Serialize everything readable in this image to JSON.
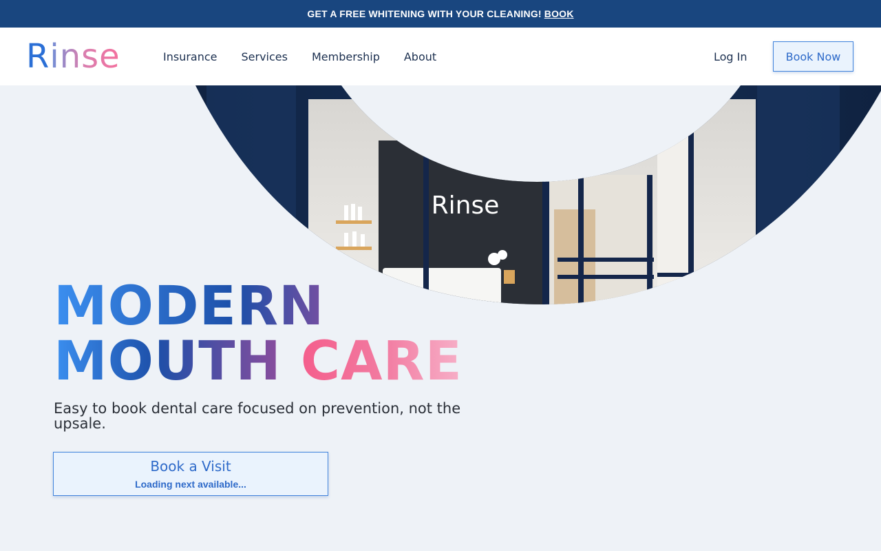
{
  "promo": {
    "text": "GET A FREE WHITENING WITH YOUR CLEANING!",
    "link": "BOOK"
  },
  "brand": {
    "logo_first": "R",
    "logo_rest": "inse",
    "sign_text": "Rinse"
  },
  "nav": {
    "items": [
      "Insurance",
      "Services",
      "Membership",
      "About"
    ],
    "login": "Log In",
    "book_now": "Book Now"
  },
  "hero": {
    "headline_word1": "MODERN",
    "headline_word2": "MOUTH",
    "headline_word3": "CARE",
    "subtitle": "Easy to book dental care focused on prevention, not the upsale.",
    "cta_label": "Book a Visit",
    "cta_sub": "Loading next available..."
  },
  "colors": {
    "promo_bg": "#19467f",
    "page_bg": "#eef2f7",
    "accent_blue": "#2e6ac9",
    "accent_pink": "#f45e8c",
    "nav_text": "#1b2f4f"
  }
}
